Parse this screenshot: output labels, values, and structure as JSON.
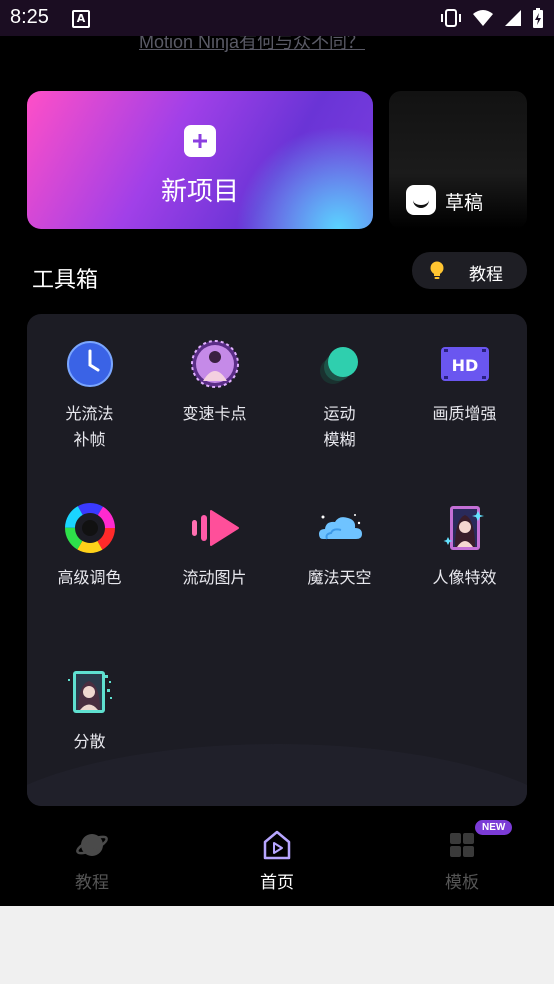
{
  "status_bar": {
    "time": "8:25",
    "notification_glyph": "A",
    "icons": [
      "vibrate-icon",
      "wifi-icon",
      "signal-icon",
      "battery-charging-icon"
    ]
  },
  "promo": {
    "text": "Motion Ninja有何与众不同？"
  },
  "new_project": {
    "label": "新项目"
  },
  "drafts": {
    "label": "草稿"
  },
  "toolbox": {
    "title": "工具箱",
    "tutorial_button": "教程",
    "tools": [
      {
        "label": "光流法\n补帧",
        "icon": "clock-icon"
      },
      {
        "label": "变速卡点",
        "icon": "dancer-badge-icon"
      },
      {
        "label": "运动\n模糊",
        "icon": "motion-blur-ball-icon"
      },
      {
        "label": "画质增强",
        "icon": "hd-film-icon"
      },
      {
        "label": "高级调色",
        "icon": "color-wheel-icon"
      },
      {
        "label": "流动图片",
        "icon": "play-bars-icon"
      },
      {
        "label": "魔法天空",
        "icon": "cloud-sky-icon"
      },
      {
        "label": "人像特效",
        "icon": "portrait-effect-icon"
      },
      {
        "label": "分散",
        "icon": "scatter-portrait-icon"
      }
    ]
  },
  "bottom_nav": {
    "items": [
      {
        "label": "教程",
        "icon": "planet-icon",
        "active": false
      },
      {
        "label": "首页",
        "icon": "home-play-icon",
        "active": true
      },
      {
        "label": "模板",
        "icon": "grid-icon",
        "active": false,
        "badge": "NEW"
      }
    ]
  },
  "colors": {
    "background": "#000000",
    "panel": "#1c1c24",
    "accent_purple": "#8b3ee0",
    "nav_active": "#ffffff",
    "nav_inactive": "#555555"
  }
}
